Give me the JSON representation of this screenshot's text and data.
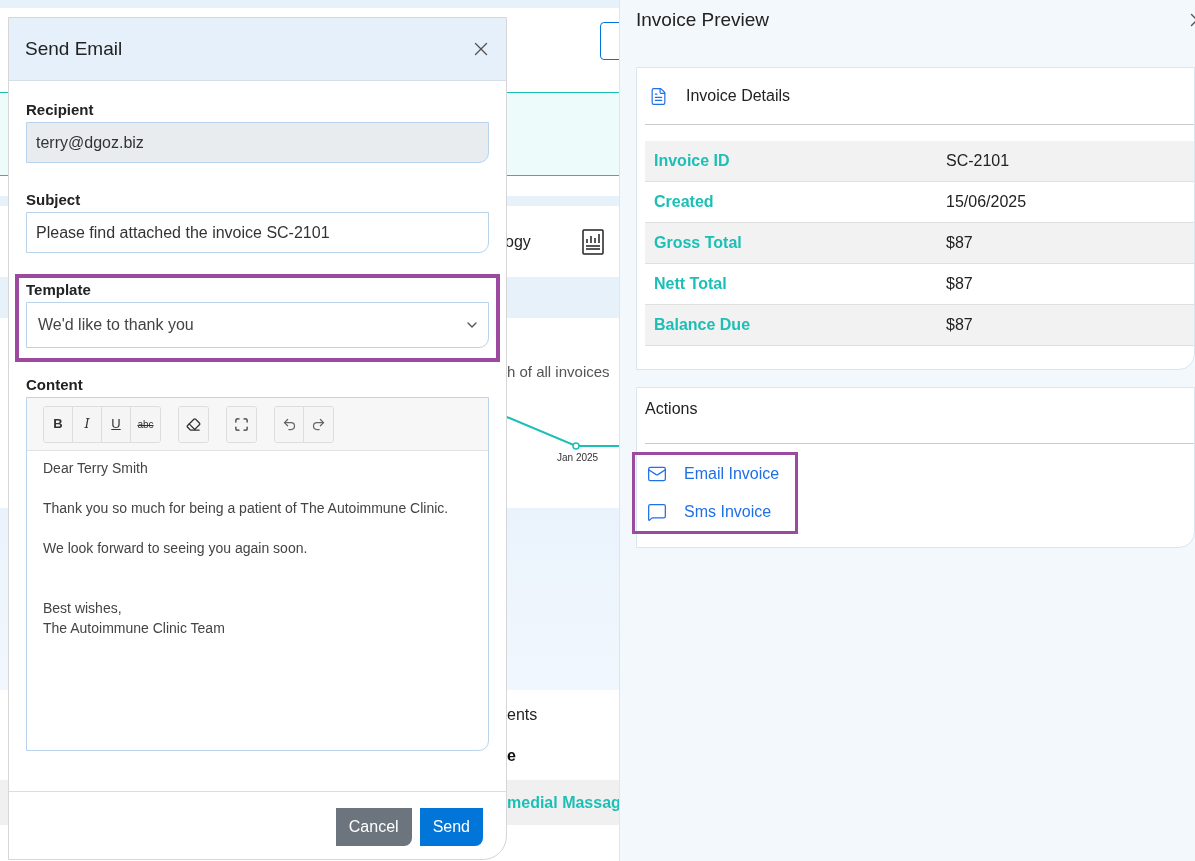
{
  "background": {
    "category_label": "ogy",
    "chart_caption": "h of all invoices",
    "chart_tick": "Jan 2025",
    "section_title": "ents",
    "column_header": "e",
    "row_cell": "medial Massag"
  },
  "modal": {
    "title": "Send Email",
    "recipient": {
      "label": "Recipient",
      "value": "terry@dgoz.biz",
      "disabled": true
    },
    "subject": {
      "label": "Subject",
      "value": "Please find attached the invoice SC-2101"
    },
    "template": {
      "label": "Template",
      "value": "We'd like to thank you",
      "highlighted": true
    },
    "content": {
      "label": "Content",
      "toolbar": [
        [
          {
            "kind": "bold",
            "label": "B"
          },
          {
            "kind": "italic",
            "label": "I"
          },
          {
            "kind": "underline",
            "label": "U"
          },
          {
            "kind": "strike",
            "label": "abc"
          }
        ],
        [
          {
            "kind": "eraser"
          }
        ],
        [
          {
            "kind": "fullscreen"
          }
        ],
        [
          {
            "kind": "undo"
          },
          {
            "kind": "redo"
          }
        ]
      ],
      "paragraphs": [
        [
          "Dear Terry Smith"
        ],
        [
          "Thank you so much for being a patient of The Autoimmune Clinic."
        ],
        [
          "We look forward to seeing you again soon."
        ],
        [
          "Best wishes,",
          "The Autoimmune Clinic Team"
        ]
      ]
    },
    "buttons": [
      {
        "kind": "secondary",
        "label": "Cancel"
      },
      {
        "kind": "primary",
        "label": "Send"
      }
    ]
  },
  "panel": {
    "title": "Invoice Preview",
    "details": {
      "title": "Invoice Details",
      "rows": [
        {
          "label": "Invoice ID",
          "value": "SC-2101"
        },
        {
          "label": "Created",
          "value": "15/06/2025"
        },
        {
          "label": "Gross Total",
          "value": "$87"
        },
        {
          "label": "Nett Total",
          "value": "$87"
        },
        {
          "label": "Balance Due",
          "value": "$87"
        }
      ]
    },
    "actions": {
      "title": "Actions",
      "highlighted": true,
      "items": [
        {
          "kind": "email",
          "label": "Email Invoice"
        },
        {
          "kind": "sms",
          "label": "Sms Invoice"
        }
      ]
    }
  }
}
